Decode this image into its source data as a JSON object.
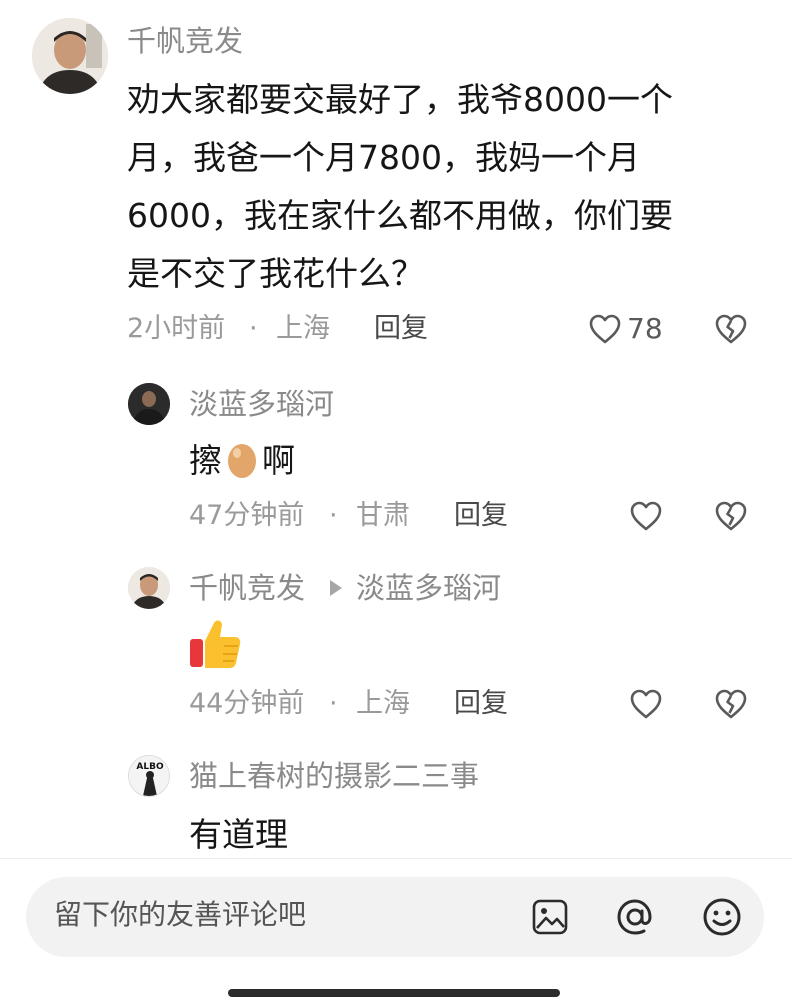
{
  "comments": [
    {
      "username": "千帆竞发",
      "text": "劝大家都要交最好了，我爷8000一个月，我爸一个月7800，我妈一个月6000，我在家什么都不用做，你们要是不交了我花什么？",
      "text_lines": [
        "劝大家都要交最好了，我爷8000一个",
        "月，我爸一个月7800，我妈一个月",
        "6000，我在家什么都不用做，你们要",
        "是不交了我花什么？"
      ],
      "time": "2小时前",
      "separator": "·",
      "location": "上海",
      "reply_label": "回复",
      "like_count": "78"
    },
    {
      "username": "淡蓝多瑙河",
      "text_before": "擦",
      "emoji": "egg",
      "text_after": "啊",
      "time": "47分钟前",
      "separator": "·",
      "location": "甘肃",
      "reply_label": "回复"
    },
    {
      "username": "千帆竞发",
      "reply_to": "淡蓝多瑙河",
      "emoji": "thumbs-up",
      "time": "44分钟前",
      "separator": "·",
      "location": "上海",
      "reply_label": "回复"
    },
    {
      "username": "猫上春树的摄影二三事",
      "avatar_text": "ALBO",
      "text": "有道理"
    }
  ],
  "input": {
    "placeholder": "留下你的友善评论吧"
  },
  "icons": {
    "like": "heart-outline-icon",
    "dislike": "broken-heart-icon",
    "image": "image-icon",
    "mention": "at-icon",
    "emoji": "smiley-icon"
  },
  "colors": {
    "username": "#8a8a8a",
    "text": "#161616",
    "meta": "#9a9a9a",
    "input_bg": "#f2f2f2"
  }
}
